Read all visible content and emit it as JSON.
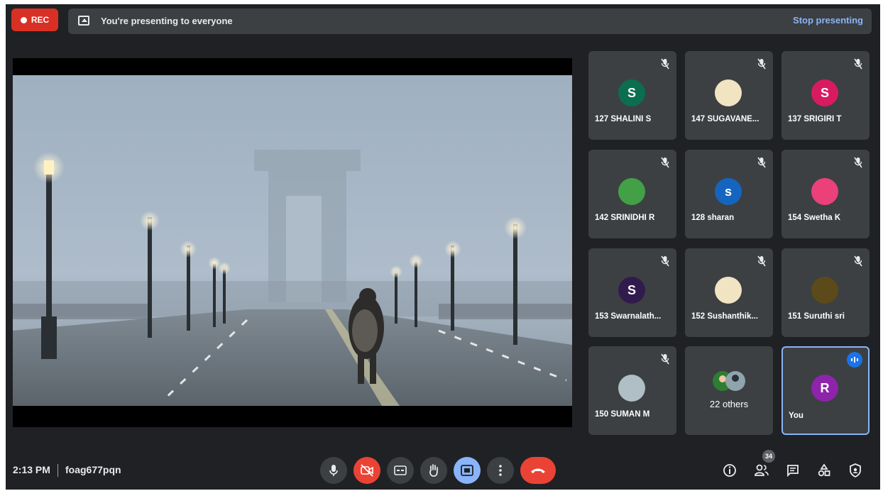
{
  "top_bar": {
    "rec_label": "REC",
    "presenting_text": "You're presenting to everyone",
    "stop_presenting": "Stop presenting"
  },
  "participants": [
    {
      "name": "127 SHALINI S",
      "initial": "S",
      "color": "#0b6e4f"
    },
    {
      "name": "147 SUGAVANE...",
      "initial": "",
      "color": "#f1e4c3"
    },
    {
      "name": "137 SRIGIRI T",
      "initial": "S",
      "color": "#d81b60"
    },
    {
      "name": "142 SRINIDHI R",
      "initial": "",
      "color": "#43a047"
    },
    {
      "name": "128 sharan",
      "initial": "s",
      "color": "#1565c0"
    },
    {
      "name": "154 Swetha K",
      "initial": "",
      "color": "#ec407a"
    },
    {
      "name": "153 Swarnalath...",
      "initial": "S",
      "color": "#311b4d"
    },
    {
      "name": "152 Sushanthik...",
      "initial": "",
      "color": "#f1e4c3"
    },
    {
      "name": "151 Suruthi sri",
      "initial": "",
      "color": "#5d4a1a"
    },
    {
      "name": "150 SUMAN M",
      "initial": "",
      "color": "#b0bec5"
    }
  ],
  "others": {
    "label": "22 others"
  },
  "you": {
    "name": "You",
    "initial": "R",
    "color": "#8e24aa"
  },
  "bottom_bar": {
    "time": "2:13 PM",
    "meeting_code": "foag677pqn",
    "participant_count": "34"
  }
}
